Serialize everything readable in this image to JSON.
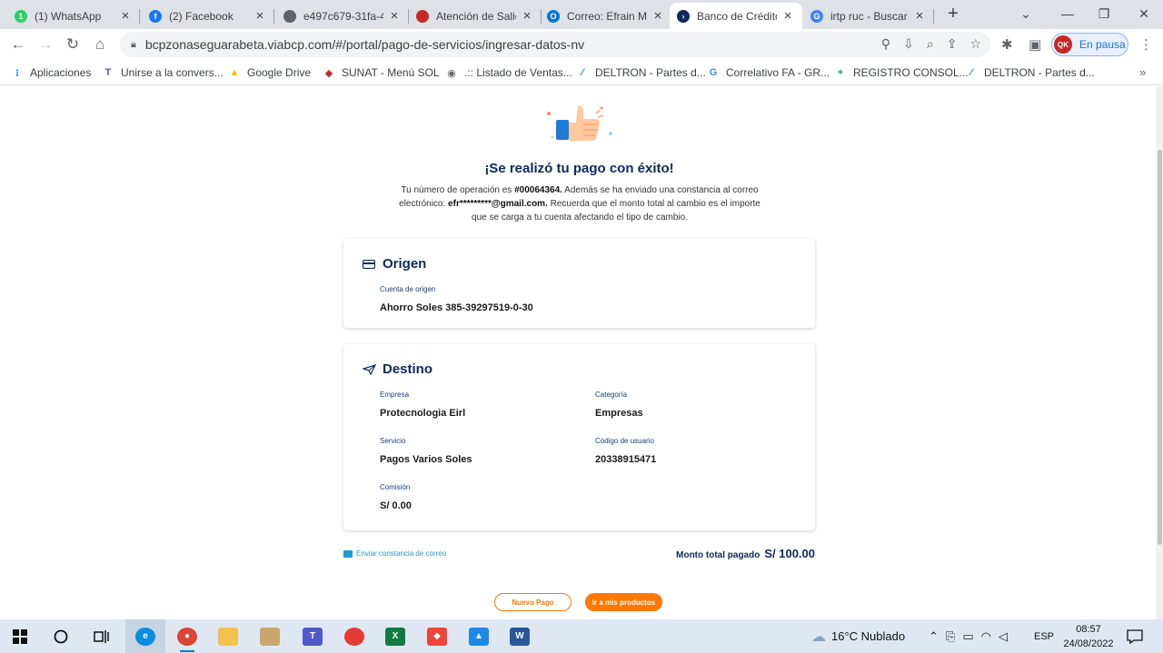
{
  "tabs": [
    {
      "title": "(1) WhatsApp",
      "icon": "whatsapp-icon",
      "color": "#25d366",
      "glyph": "1"
    },
    {
      "title": "(2) Facebook",
      "icon": "facebook-icon",
      "color": "#1877f2",
      "glyph": "f"
    },
    {
      "title": "e497c679-31fa-4",
      "icon": "globe-icon",
      "color": "#5f6368",
      "glyph": ""
    },
    {
      "title": "Atención de Salid",
      "icon": "brand-icon",
      "color": "#c62828",
      "glyph": ""
    },
    {
      "title": "Correo: Efrain Me",
      "icon": "outlook-icon",
      "color": "#0078d4",
      "glyph": "O"
    },
    {
      "title": "Banco de Crédito",
      "icon": "bcp-icon",
      "color": "#0c2a5b",
      "glyph": "›",
      "active": true
    },
    {
      "title": "irtp ruc - Buscar c",
      "icon": "google-icon",
      "color": "#4285f4",
      "glyph": "G"
    }
  ],
  "browser": {
    "url": "bcpzonaseguarabeta.viabcp.com/#/portal/pago-de-servicios/ingresar-datos-nv",
    "profile_label": "En pausa"
  },
  "bookmarks": [
    {
      "label": "Aplicaciones",
      "icon": "apps-icon",
      "color": "#4285f4",
      "glyph": "⁝"
    },
    {
      "label": "Unirse a la convers...",
      "icon": "teams-icon",
      "color": "#5059c9",
      "glyph": "T"
    },
    {
      "label": "Google Drive",
      "icon": "drive-icon",
      "color": "#fbbc04",
      "glyph": "▲"
    },
    {
      "label": "SUNAT - Menú SOL",
      "icon": "sunat-icon",
      "color": "#c62828",
      "glyph": "◆"
    },
    {
      "label": ".:: Listado de Ventas...",
      "icon": "globe-icon",
      "color": "#5f6368",
      "glyph": ""
    },
    {
      "label": "DELTRON - Partes d...",
      "icon": "deltron-icon",
      "color": "#1a73e8",
      "glyph": "⁄"
    },
    {
      "label": "Correlativo FA - GR...",
      "icon": "google-icon",
      "color": "#4285f4",
      "glyph": "G"
    },
    {
      "label": "REGISTRO CONSOL...",
      "icon": "sheets-icon",
      "color": "#0f9d58",
      "glyph": "+"
    },
    {
      "label": "DELTRON - Partes d...",
      "icon": "deltron-icon",
      "color": "#1a73e8",
      "glyph": "⁄"
    }
  ],
  "page": {
    "headline": "¡Se realizó tu pago con éxito!",
    "desc": {
      "p1": "Tu número de operación es ",
      "op": "#00064364.",
      "p2": " Además se ha enviado una constancia al correo electrónico: ",
      "email": "efr*********@gmail.com.",
      "p3": " Recuerda que el monto total al cambio es el importe que se carga a tu cuenta afectando el tipo de cambio."
    },
    "origin": {
      "title": "Origen",
      "account_label": "Cuenta de origen",
      "account_value": "Ahorro Soles 385-39297519-0-30"
    },
    "destination": {
      "title": "Destino",
      "company_label": "Empresa",
      "company_value": "Protecnologia Eirl",
      "category_label": "Categoría",
      "category_value": "Empresas",
      "service_label": "Servicio",
      "service_value": "Pagos Varios Soles",
      "user_code_label": "Código de usuario",
      "user_code_value": "20338915471",
      "commission_label": "Comisión",
      "commission_value": "S/ 0.00"
    },
    "send_receipt": "Enviar constancia de correo",
    "total_label": "Monto total pagado",
    "total_value": "S/ 100.00",
    "new_payment": "Nuevo Pago",
    "go_products": "Ir a mis productos"
  },
  "taskbar": {
    "weather": "16°C  Nublado",
    "lang": "ESP",
    "time": "08:57",
    "date": "24/08/2022"
  }
}
